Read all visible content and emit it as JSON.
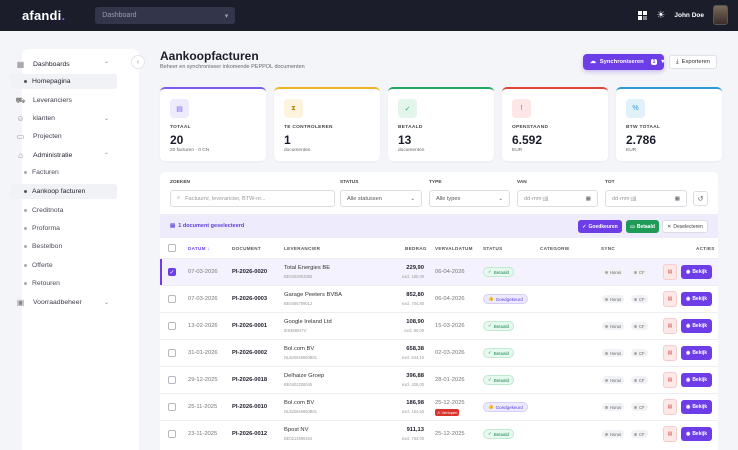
{
  "topbar": {
    "logo": "afandi",
    "dashboard_select": "Dashboard",
    "user_name": "John Doe"
  },
  "sidebar": {
    "items": [
      {
        "label": "Dashboards"
      },
      {
        "label": "Homepagina"
      },
      {
        "label": "Leveranciers"
      },
      {
        "label": "klanten"
      },
      {
        "label": "Projecten"
      },
      {
        "label": "Administratie"
      },
      {
        "label": "Facturen"
      },
      {
        "label": "Aankoop facturen"
      },
      {
        "label": "Creditnota"
      },
      {
        "label": "Proforma"
      },
      {
        "label": "Bestelbon"
      },
      {
        "label": "Offerte"
      },
      {
        "label": "Retouren"
      },
      {
        "label": "Voorraadbeheer"
      }
    ]
  },
  "header": {
    "title": "Aankoopfacturen",
    "subtitle": "Beheer en synchroniseer inkomende PEPPOL documenten",
    "sync_label": "Synchroniseren",
    "sync_count": "1",
    "export_label": "Exporteren"
  },
  "cards": [
    {
      "label": "TOTAAL",
      "value": "20",
      "sub": "20 facturen · 0 CN",
      "color": "#7c5cf0",
      "icon_bg": "#eeebfd",
      "icon_fg": "#7c5cf0",
      "icon": "doc-icon"
    },
    {
      "label": "TE CONTROLEREN",
      "value": "1",
      "sub": "documenten",
      "color": "#f0b429",
      "icon_bg": "#fdf4df",
      "icon_fg": "#c58b12",
      "icon": "hourglass-icon"
    },
    {
      "label": "BETAALD",
      "value": "13",
      "sub": "documenten",
      "color": "#22a861",
      "icon_bg": "#e4f6ec",
      "icon_fg": "#22a861",
      "icon": "check-icon"
    },
    {
      "label": "OPENSTAAND",
      "value": "6.592",
      "sub": "EUR",
      "color": "#e0443b",
      "icon_bg": "#fde6e5",
      "icon_fg": "#e0443b",
      "icon": "alert-icon"
    },
    {
      "label": "BTW TOTAAL",
      "value": "2.786",
      "sub": "EUR",
      "color": "#2f9bd6",
      "icon_bg": "#e1f1fa",
      "icon_fg": "#2f9bd6",
      "icon": "percent-icon"
    }
  ],
  "filters": {
    "search_label": "ZOEKEN",
    "search_placeholder": "Factuurnr, leverancier, BTW-nr...",
    "status_label": "STATUS",
    "status_value": "Alle statussen",
    "type_label": "TYPE",
    "type_value": "Alle types",
    "from_label": "VAN",
    "from_value": "dd-mm-jjjj",
    "to_label": "TOT",
    "to_value": "dd-mm-jjjj"
  },
  "selection": {
    "text": "1 document geselecteerd",
    "approve_label": "Goedkeuren",
    "paid_label": "Betaald",
    "deselect_label": "Deselecteren"
  },
  "table": {
    "headers": {
      "date": "DATUM",
      "document": "DOCUMENT",
      "supplier": "LEVERANCIER",
      "amount": "BEDRAG",
      "due": "VERVALDATUM",
      "status": "STATUS",
      "category": "CATEGORIE",
      "sync": "SYNC",
      "actions": "ACTIES"
    },
    "rows": [
      {
        "date": "07-03-2026",
        "doc": "PI-2026-0020",
        "supplier": "Total Energies BE",
        "vat": "BE0403063385",
        "amount": "229,90",
        "excl": "excl. 190,00",
        "due": "06-04-2026",
        "status": "Betaald",
        "status_type": "paid",
        "selected": true
      },
      {
        "date": "07-03-2026",
        "doc": "PI-2026-0003",
        "supplier": "Garage Peeters BVBA",
        "vat": "BE0456789012",
        "amount": "852,80",
        "excl": "excl. 704,80",
        "due": "06-04-2026",
        "status": "Goedgekeurd",
        "status_type": "approved",
        "selected": false
      },
      {
        "date": "13-02-2026",
        "doc": "PI-2026-0001",
        "supplier": "Google Ireland Ltd",
        "vat": "IE6388047V",
        "amount": "108,90",
        "excl": "excl. 90,00",
        "due": "15-03-2026",
        "status": "Betaald",
        "status_type": "paid",
        "selected": false
      },
      {
        "date": "31-01-2026",
        "doc": "PI-2026-0002",
        "supplier": "Bol.com BV",
        "vat": "NL820646660B01",
        "amount": "658,38",
        "excl": "excl. 544,10",
        "due": "02-03-2026",
        "status": "Betaald",
        "status_type": "paid",
        "selected": false
      },
      {
        "date": "29-12-2025",
        "doc": "PI-2026-0018",
        "supplier": "Delhaize Groep",
        "vat": "BE0402206045",
        "amount": "396,88",
        "excl": "excl. 328,00",
        "due": "28-01-2026",
        "status": "Betaald",
        "status_type": "paid",
        "selected": false
      },
      {
        "date": "25-11-2025",
        "doc": "PI-2026-0010",
        "supplier": "Bol.com BV",
        "vat": "NL820646660B01",
        "amount": "186,98",
        "excl": "excl. 154,53",
        "due": "25-12-2025",
        "overdue": "Verlopen",
        "status": "Goedgekeurd",
        "status_type": "approved",
        "selected": false
      },
      {
        "date": "23-11-2025",
        "doc": "PI-2026-0012",
        "supplier": "Bpost NV",
        "vat": "BE0214596464",
        "amount": "911,13",
        "excl": "excl. 753,00",
        "due": "25-12-2025",
        "status": "Betaald",
        "status_type": "paid",
        "selected": false
      }
    ],
    "sync_chip_1": "Horus",
    "sync_chip_2": "CF",
    "view_label": "Bekijk"
  }
}
